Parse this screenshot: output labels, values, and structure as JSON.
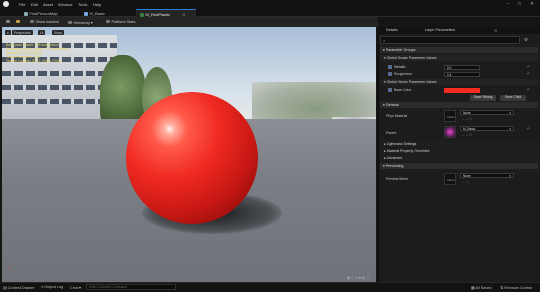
{
  "menu": [
    "File",
    "Edit",
    "Asset",
    "Window",
    "Tools",
    "Help"
  ],
  "tabs": [
    {
      "label": "FirstPersonMap",
      "active": false
    },
    {
      "label": "M_Basic",
      "active": false
    },
    {
      "label": "M_RedPlastic",
      "active": true
    }
  ],
  "toolbar": {
    "save_label": "",
    "show_inactive": "Show Inactive",
    "hierarchy": "Hierarchy",
    "platform": "Platform Stats"
  },
  "viewport": {
    "buttons": [
      "Perspective",
      "Lit",
      "Show"
    ],
    "stats": [
      "Base pass shader: 195 instructions",
      "Base pass vertex shader: 137 instructions",
      "Samplers: 3/16 (D3D11)",
      "Texture samplers: 2/16",
      "Texture Lookups (Est.): VS(0), PS(0)"
    ]
  },
  "details": {
    "tabs": [
      "Details",
      "Layer Parameters"
    ],
    "sections": {
      "parameter_groups": "Parameter Groups",
      "scalar_group": "Global Scalar Parameter Values",
      "vector_group": "Global Vector Parameter Values",
      "general": "General",
      "lightmass": "Lightmass Settings",
      "overrides": "Material Property Overrides",
      "advanced": "Advanced",
      "previewing": "Previewing"
    },
    "params": {
      "metallic_label": "Metallic",
      "metallic_value": "0.0",
      "roughness_label": "Roughness",
      "roughness_value": "0.4",
      "base_color_label": "Base Color",
      "base_color_hex": "#f52a22"
    },
    "buttons": {
      "save_sibling": "Save Sibling",
      "save_child": "Save Child"
    },
    "general": {
      "phys_material_label": "Phys Material",
      "phys_material_value": "None",
      "parent_label": "Parent",
      "parent_value": "M_Basic"
    },
    "previewing": {
      "preview_mesh_label": "Preview Mesh",
      "preview_mesh_value": "None"
    }
  },
  "status": {
    "content_drawer": "Content Drawer",
    "output_log": "Output Log",
    "cmd": "Cmd",
    "cmd_placeholder": "Enter Console Command",
    "all_saved": "All Saved",
    "revision_control": "Revision Control"
  },
  "colors": {
    "accent": "#2c7bd9",
    "sphere": "#e8231c"
  }
}
